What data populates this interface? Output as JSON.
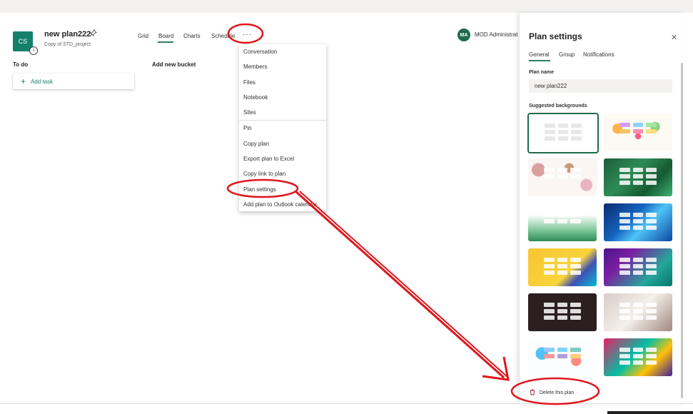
{
  "plan": {
    "initials": "CS",
    "name": "new plan222",
    "subtitle": "Copy of STD_project"
  },
  "views": {
    "grid": "Grid",
    "board": "Board",
    "charts": "Charts",
    "schedule": "Schedule",
    "more": "···"
  },
  "buckets": {
    "todo": "To do",
    "add_bucket": "Add new bucket",
    "add_task": "Add task"
  },
  "menu": {
    "items": [
      "Conversation",
      "Members",
      "Files",
      "Notebook",
      "Sites",
      "Pin",
      "Copy plan",
      "Export plan to Excel",
      "Copy link to plan",
      "Plan settings",
      "Add plan to Outlook calendar"
    ]
  },
  "owner": {
    "initials": "MA",
    "name": "MOD Administrat"
  },
  "settings": {
    "title": "Plan settings",
    "tabs": [
      "General",
      "Group",
      "Notifications"
    ],
    "plan_name_label": "Plan name",
    "plan_name_value": "new plan222",
    "backgrounds_label": "Suggested backgrounds",
    "delete_label": "Delete this plan"
  },
  "colors": {
    "accent": "#14806b",
    "annotation": "#e0161c",
    "delete": "#a4262c"
  },
  "icons": {
    "pin": "pin-icon",
    "close": "close-icon",
    "plus": "plus-icon",
    "trash": "trash-icon",
    "info": "info-icon",
    "more": "more-icon"
  }
}
